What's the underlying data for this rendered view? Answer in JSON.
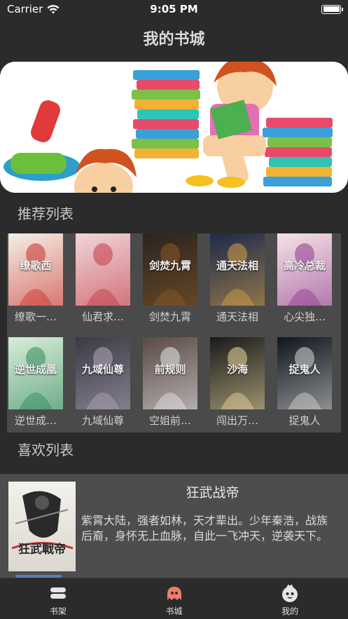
{
  "status_bar": {
    "carrier": "Carrier",
    "time": "9:05 PM"
  },
  "nav": {
    "title": "我的书城"
  },
  "sections": {
    "recommended": "推荐列表",
    "favorites": "喜欢列表"
  },
  "recommended_books": [
    {
      "name": "缭歌一…",
      "cover_text": "缭歌西",
      "cover_bg": "#f4efe6",
      "cover_accent": "#c9302c"
    },
    {
      "name": "仙君求…",
      "cover_text": "",
      "cover_bg": "#f0d6da",
      "cover_accent": "#c23a45"
    },
    {
      "name": "剑焚九霄",
      "cover_text": "剑焚九霄",
      "cover_bg": "#2a241f",
      "cover_accent": "#8a5a2a"
    },
    {
      "name": "通天法相",
      "cover_text": "通天法相",
      "cover_bg": "#1c2a4a",
      "cover_accent": "#d4a24a"
    },
    {
      "name": "心尖独…",
      "cover_text": "高冷总裁",
      "cover_bg": "#f5e2e6",
      "cover_accent": "#8e3a8e"
    },
    {
      "name": "逆世成…",
      "cover_text": "逆世成凰",
      "cover_bg": "#d8ecd9",
      "cover_accent": "#2f8a5a"
    },
    {
      "name": "九域仙尊",
      "cover_text": "九域仙尊",
      "cover_bg": "#3a3a46",
      "cover_accent": "#b0a7b8"
    },
    {
      "name": "空姐前…",
      "cover_text": "前规则",
      "cover_bg": "#5a4a46",
      "cover_accent": "#e8e8e8"
    },
    {
      "name": "闯出万…",
      "cover_text": "沙海",
      "cover_bg": "#1a1a1a",
      "cover_accent": "#e8d9a0"
    },
    {
      "name": "捉鬼人",
      "cover_text": "捉鬼人",
      "cover_bg": "#10161e",
      "cover_accent": "#d6d6d6"
    }
  ],
  "favorite": {
    "title": "狂武战帝",
    "cover_text": "狂武戰帝",
    "description": "紫霄大陆，强者如林，天才辈出。少年秦浩，战族后裔，身怀无上血脉，自此一飞冲天，逆袭天下。"
  },
  "tabs": [
    {
      "label": "书架",
      "icon": "bookshelf-icon",
      "active": false
    },
    {
      "label": "书城",
      "icon": "bookstore-icon",
      "active": true
    },
    {
      "label": "我的",
      "icon": "profile-icon",
      "active": false
    }
  ],
  "colors": {
    "accent": "#f07d6a",
    "background": "#2b2b2b",
    "panel": "#4a4a4a"
  }
}
